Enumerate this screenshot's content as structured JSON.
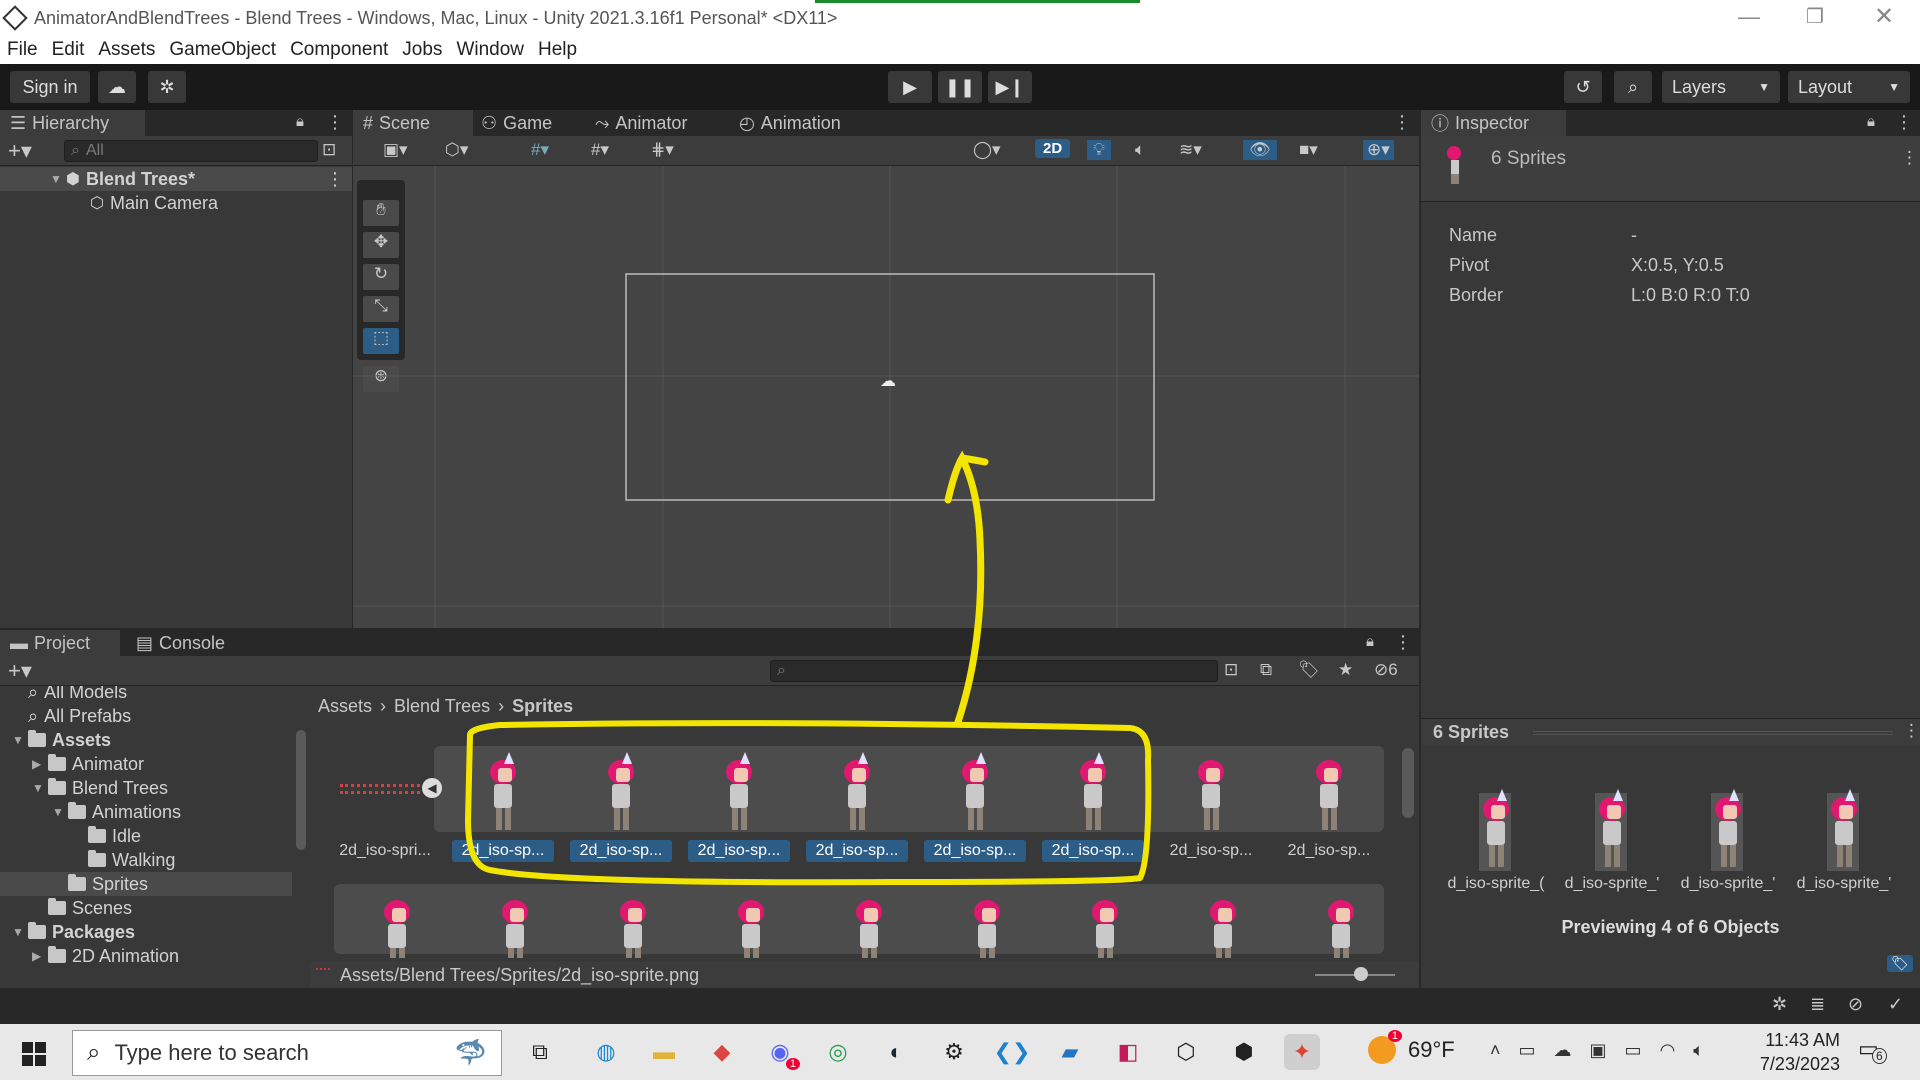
{
  "window": {
    "title": "AnimatorAndBlendTrees - Blend Trees - Windows, Mac, Linux - Unity 2021.3.16f1 Personal* <DX11>"
  },
  "menu": [
    "File",
    "Edit",
    "Assets",
    "GameObject",
    "Component",
    "Jobs",
    "Window",
    "Help"
  ],
  "toolbar": {
    "sign_in": "Sign in",
    "layers": "Layers",
    "layout": "Layout"
  },
  "hierarchy": {
    "tab": "Hierarchy",
    "search_placeholder": "All",
    "scene_name": "Blend Trees*",
    "items": [
      "Main Camera"
    ]
  },
  "scene_tabs": [
    "Scene",
    "Game",
    "Animator",
    "Animation"
  ],
  "scene_toolbar": {
    "mode_2d": "2D"
  },
  "inspector": {
    "tab": "Inspector",
    "header": "6 Sprites",
    "props": [
      {
        "label": "Name",
        "value": "-"
      },
      {
        "label": "Pivot",
        "value": "X:0.5, Y:0.5"
      },
      {
        "label": "Border",
        "value": "L:0 B:0 R:0 T:0"
      }
    ],
    "preview_title": "6 Sprites",
    "preview_labels": [
      "d_iso-sprite_(",
      "d_iso-sprite_'",
      "d_iso-sprite_'",
      "d_iso-sprite_'"
    ],
    "preview_caption": "Previewing 4 of 6 Objects"
  },
  "project": {
    "tabs": [
      "Project",
      "Console"
    ],
    "hidden_count": "6",
    "tree": [
      {
        "label": "All Models",
        "indent": 0,
        "type": "search"
      },
      {
        "label": "All Prefabs",
        "indent": 0,
        "type": "search"
      },
      {
        "label": "Assets",
        "indent": 0,
        "type": "folder",
        "bold": true,
        "tri": "▼"
      },
      {
        "label": "Animator",
        "indent": 1,
        "type": "folder",
        "tri": "▶"
      },
      {
        "label": "Blend Trees",
        "indent": 1,
        "type": "folder",
        "tri": "▼"
      },
      {
        "label": "Animations",
        "indent": 2,
        "type": "folder",
        "tri": "▼"
      },
      {
        "label": "Idle",
        "indent": 3,
        "type": "folder",
        "tri": ""
      },
      {
        "label": "Walking",
        "indent": 3,
        "type": "folder",
        "tri": ""
      },
      {
        "label": "Sprites",
        "indent": 2,
        "type": "folder",
        "tri": "",
        "selected": true
      },
      {
        "label": "Scenes",
        "indent": 1,
        "type": "folder",
        "tri": ""
      },
      {
        "label": "Packages",
        "indent": 0,
        "type": "folder",
        "bold": true,
        "tri": "▼"
      },
      {
        "label": "2D Animation",
        "indent": 1,
        "type": "folder",
        "tri": "▶"
      }
    ],
    "breadcrumb": [
      "Assets",
      "Blend Trees",
      "Sprites"
    ],
    "row1": [
      {
        "label": "2d_iso-spri...",
        "selected": false,
        "hat": false,
        "kind": "sheet"
      },
      {
        "label": "2d_iso-sp...",
        "selected": true,
        "hat": true
      },
      {
        "label": "2d_iso-sp...",
        "selected": true,
        "hat": true
      },
      {
        "label": "2d_iso-sp...",
        "selected": true,
        "hat": true
      },
      {
        "label": "2d_iso-sp...",
        "selected": true,
        "hat": true
      },
      {
        "label": "2d_iso-sp...",
        "selected": true,
        "hat": true
      },
      {
        "label": "2d_iso-sp...",
        "selected": true,
        "hat": true
      },
      {
        "label": "2d_iso-sp...",
        "selected": false,
        "hat": false
      },
      {
        "label": "2d_iso-sp...",
        "selected": false,
        "hat": false
      }
    ],
    "row2_count": 9,
    "status_path": "Assets/Blend Trees/Sprites/2d_iso-sprite.png"
  },
  "taskbar": {
    "search_placeholder": "Type here to search",
    "weather": "69°F",
    "time": "11:43 AM",
    "date": "7/23/2023",
    "notif_count": "6",
    "discord_badge": "1",
    "weather_badge": "1"
  },
  "colors": {
    "annotation": "#f2e600",
    "selection": "#2c5d87",
    "sprite_hair": "#e0186f"
  }
}
